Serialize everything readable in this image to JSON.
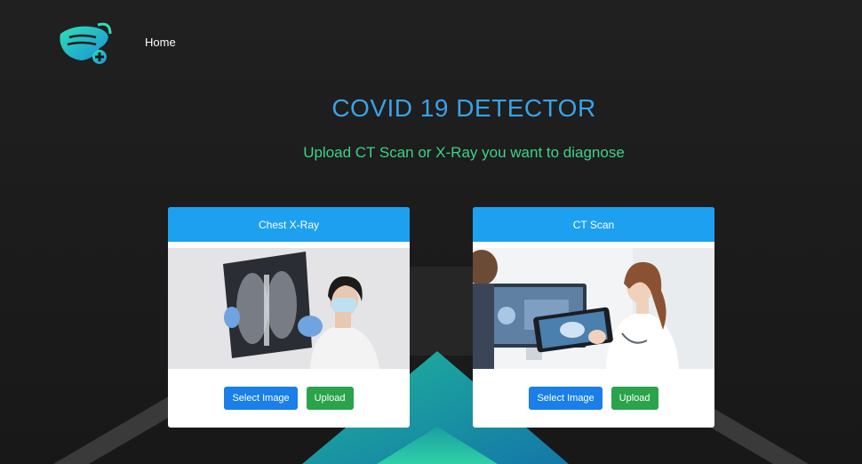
{
  "navbar": {
    "logo_icon": "face-mask-plus-icon",
    "home_label": "Home"
  },
  "main": {
    "title": "COVID 19 DETECTOR",
    "subtitle": "Upload CT Scan or X-Ray you want to diagnose"
  },
  "cards": [
    {
      "header": "Chest X-Ray",
      "image": "doctor-holding-chest-xray-image",
      "select_label": "Select Image",
      "upload_label": "Upload"
    },
    {
      "header": "CT Scan",
      "image": "doctor-with-tablet-ct-scan-image",
      "select_label": "Select Image",
      "upload_label": "Upload"
    }
  ],
  "colors": {
    "background": "#1c1c1c",
    "title": "#3aa2e6",
    "subtitle": "#3ed18b",
    "card_header": "#1ea0f0",
    "select_button": "#1a7fe8",
    "upload_button": "#2aa34a"
  }
}
